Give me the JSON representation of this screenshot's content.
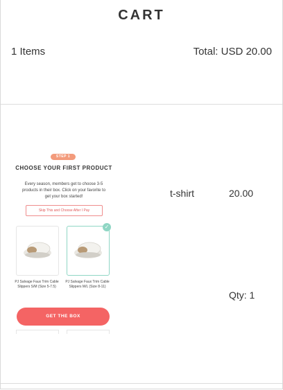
{
  "header": {
    "title": "CART"
  },
  "summary": {
    "items_count": "1 Items",
    "total": "Total: USD 20.00"
  },
  "cart_item": {
    "name": "t-shirt",
    "price": "20.00",
    "qty": "Qty: 1",
    "thumbnail": {
      "step_badge": "STEP 1",
      "heading": "CHOOSE YOUR FIRST PRODUCT",
      "description": "Every season, members get to choose 3-5 products in their box. Click on your favorite to get your box started!",
      "skip_button": "Skip This and Choose After I Pay",
      "products": [
        {
          "caption": "PJ Salvage Faux Trim Cable Slippers S/M (Size 5-7.5)"
        },
        {
          "caption": "PJ Salvage Faux Trim Cable Slippers M/L (Size 8-11)"
        }
      ],
      "cta_button": "GET THE BOX"
    }
  },
  "colors": {
    "accent": "#f46464",
    "selected": "#8fd6c4",
    "step": "#f39b7c"
  }
}
